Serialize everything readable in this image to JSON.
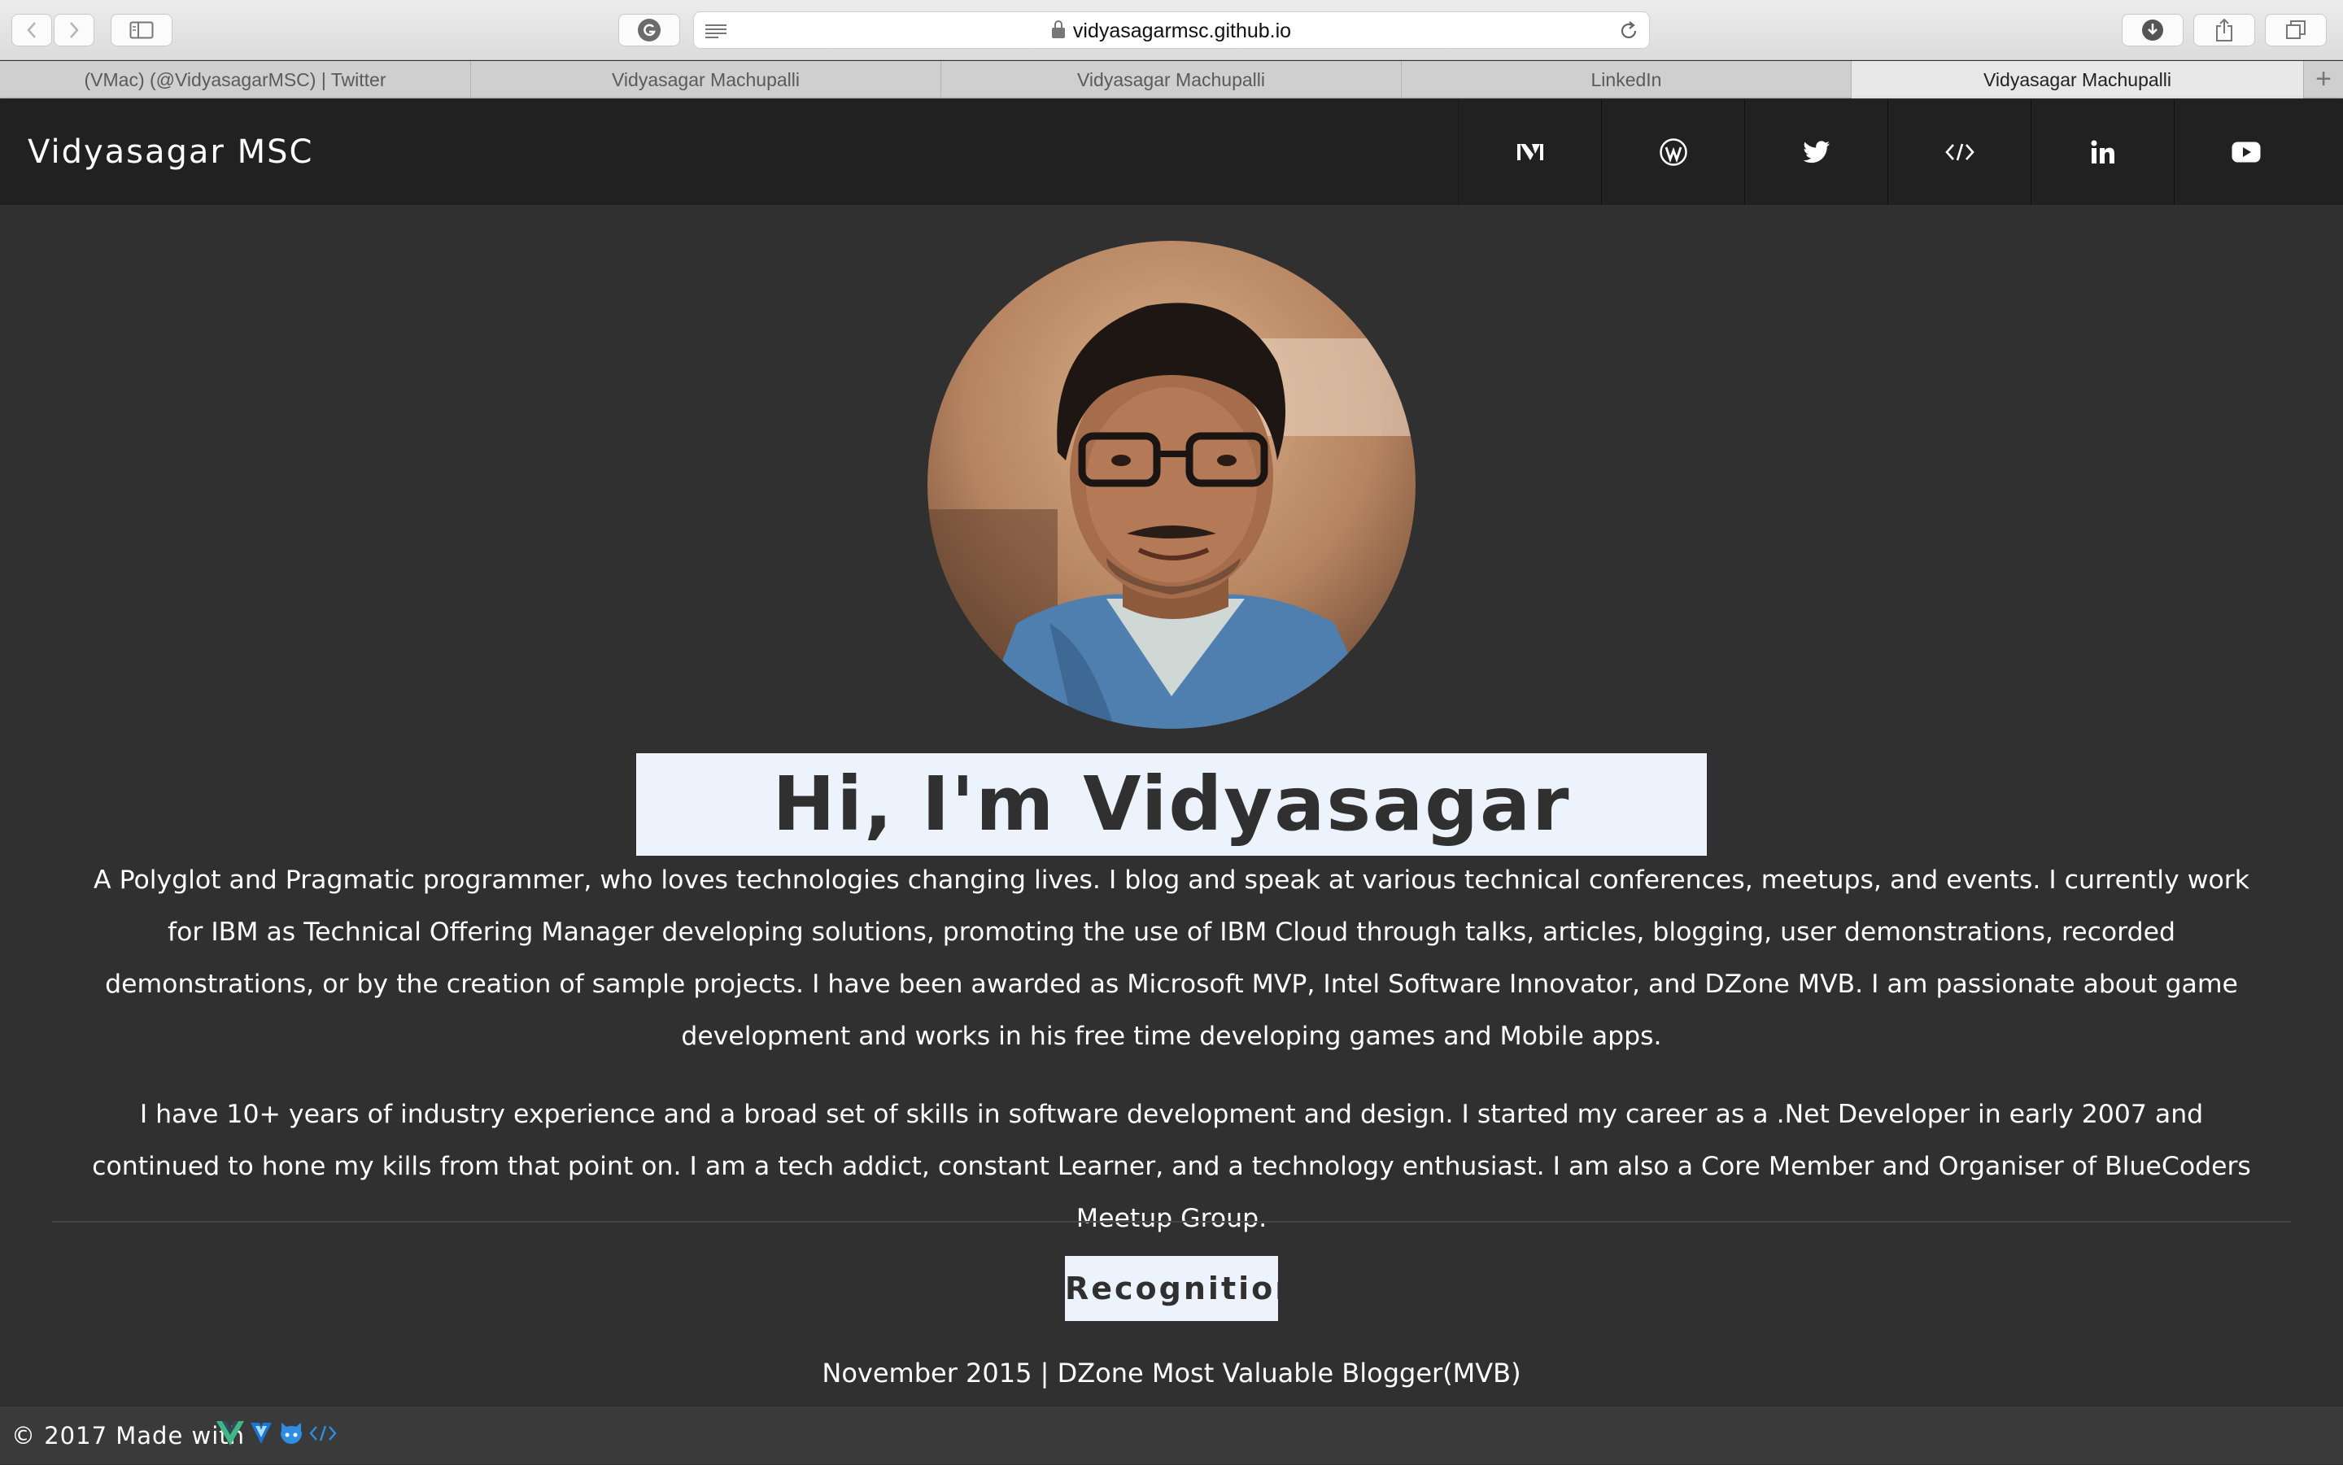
{
  "browser": {
    "url": "vidyasagarmsc.github.io",
    "tabs": [
      {
        "label": "(VMac) (@VidyasagarMSC) | Twitter",
        "active": false
      },
      {
        "label": "Vidyasagar Machupalli",
        "active": false
      },
      {
        "label": "Vidyasagar Machupalli",
        "active": false
      },
      {
        "label": "LinkedIn",
        "active": false
      },
      {
        "label": "Vidyasagar Machupalli",
        "active": true
      }
    ],
    "toolbar_icons": [
      "back-icon",
      "forward-icon",
      "sidebar-icon",
      "grammarly-icon",
      "reader-icon",
      "lock-icon",
      "reload-icon",
      "downloads-icon",
      "share-icon",
      "tabs-overview-icon",
      "new-tab-icon"
    ]
  },
  "site": {
    "brand": "Vidyasagar MSC",
    "nav_icons": [
      "medium-icon",
      "wordpress-icon",
      "twitter-icon",
      "code-icon",
      "linkedin-icon",
      "youtube-icon"
    ]
  },
  "hero": {
    "title": "Hi, I'm Vidyasagar Machupalli",
    "paragraph1": "A Polyglot and Pragmatic programmer, who loves technologies changing lives. I blog and speak at various technical conferences, meetups, and events. I currently work for IBM as Technical Offering Manager developing solutions, promoting the use of IBM Cloud through talks, articles, blogging, user demonstrations, recorded demonstrations, or by the creation of sample projects. I have been awarded as Microsoft MVP, Intel Software Innovator, and DZone MVB. I am passionate about game development and works in his free time developing games and Mobile apps.",
    "paragraph2": "I have 10+ years of industry experience and a broad set of skills in software development and design. I started my career as a .Net Developer in early 2007 and continued to hone my kills from that point on. I am a tech addict, constant Learner, and a technology enthusiast. I am also a Core Member and Organiser of BlueCoders Meetup Group."
  },
  "recognitions": {
    "title": "Recognitions",
    "items": [
      "November 2015 | DZone Most Valuable Blogger(MVB)"
    ]
  },
  "footer": {
    "text": "© 2017 Made with",
    "icons": [
      "vue-icon",
      "vuetify-icon",
      "github-icon",
      "code-icon"
    ]
  },
  "colors": {
    "page_bg": "#303030",
    "nav_bg": "#212121",
    "highlight_bg": "#edf3fc",
    "text": "#ffffff",
    "vue_green": "#41b883",
    "vuetify_blue": "#1976d2"
  }
}
